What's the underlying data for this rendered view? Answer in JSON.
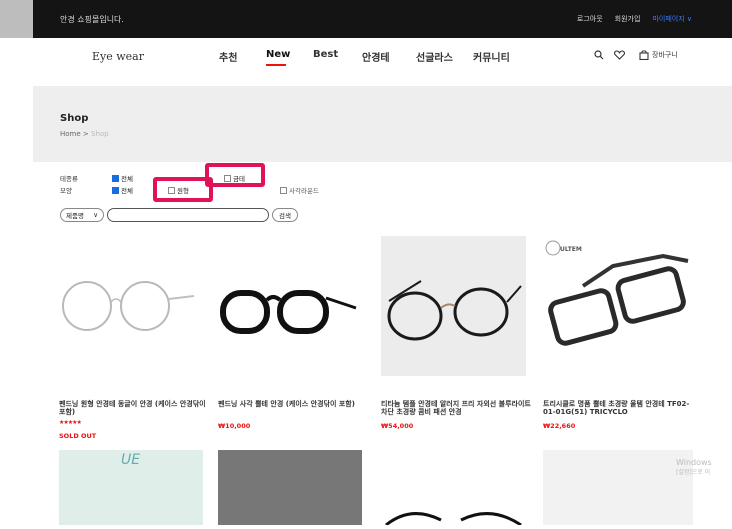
{
  "topbar": {
    "welcome": "안경 쇼핑몰입니다.",
    "login": "로그아웃",
    "join": "회원가입",
    "mypage": "마이페이지 ∨"
  },
  "header": {
    "logo": "Eye wear",
    "nav": [
      "추천",
      "New",
      "Best",
      "안경테",
      "선글라스",
      "커뮤니티"
    ],
    "active_nav": "New",
    "cart_label": "장바구니"
  },
  "shop": {
    "title": "Shop",
    "breadcrumb_home": "Home",
    "breadcrumb_sep": ">",
    "breadcrumb_current": "Shop"
  },
  "filters": {
    "frame_label": "테종류",
    "shape_label": "모양",
    "frame_all": "전체",
    "frame_metal": "금테",
    "shape_all": "전체",
    "shape_round": "원형",
    "shape_square": "사각라운드"
  },
  "search": {
    "select_value": "제품명",
    "button": "검색"
  },
  "products": [
    {
      "name": "펜드닝 원형 안경테 동글이 안경 (케이스 안경닦이 포함)",
      "stars": "★★★★★",
      "status": "SOLD OUT",
      "price": ""
    },
    {
      "name": "펜드닝 사각 뿔테 안경 (케이스 안경닦이 포함)",
      "price": "₩10,000"
    },
    {
      "name": "티타늄 템플 안경테 알러지 프리 자외선 블루라이트 차단 초경량 콤비 패션 안경",
      "price": "₩54,000"
    },
    {
      "name": "트리시클로 명품 뿔테 초경량 울템 안경테 TF02-01-01G(51) TRICYCLO",
      "price": "₩22,660",
      "brand": "ULTEM"
    }
  ],
  "watermark": {
    "line1": "Windows",
    "line2": "[설정]으로 이"
  },
  "colors": {
    "accent_red": "#e11111",
    "highlight": "#e0125a",
    "checkbox_blue": "#1a6bde",
    "topbar": "#141414"
  }
}
